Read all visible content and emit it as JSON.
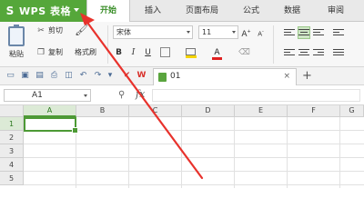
{
  "app": {
    "title": "WPS 表格",
    "logo": "S"
  },
  "tabs": [
    {
      "label": "开始",
      "active": true
    },
    {
      "label": "插入"
    },
    {
      "label": "页面布局"
    },
    {
      "label": "公式"
    },
    {
      "label": "数据"
    },
    {
      "label": "审阅"
    }
  ],
  "ribbon": {
    "paste_label": "粘贴",
    "cut_label": "剪切",
    "copy_label": "复制",
    "format_painter_label": "格式刷",
    "font_name": "宋体",
    "font_size": "11",
    "bold": "B",
    "italic": "I",
    "underline": "U",
    "font_color_glyph": "A"
  },
  "document": {
    "tab_name": "01",
    "close_glyph": "×",
    "new_tab_glyph": "+"
  },
  "formula_bar": {
    "cell_ref": "A1",
    "fx": "fx",
    "zoom_glyph": "⚲"
  },
  "grid": {
    "columns": [
      "A",
      "B",
      "C",
      "D",
      "E",
      "F",
      "G"
    ],
    "rows": [
      "1",
      "2",
      "3",
      "4",
      "5"
    ],
    "selected_cell": "A1"
  },
  "colors": {
    "brand_green": "#55a73a",
    "active_green": "#4d9a35",
    "arrow_red": "#e8322c"
  }
}
